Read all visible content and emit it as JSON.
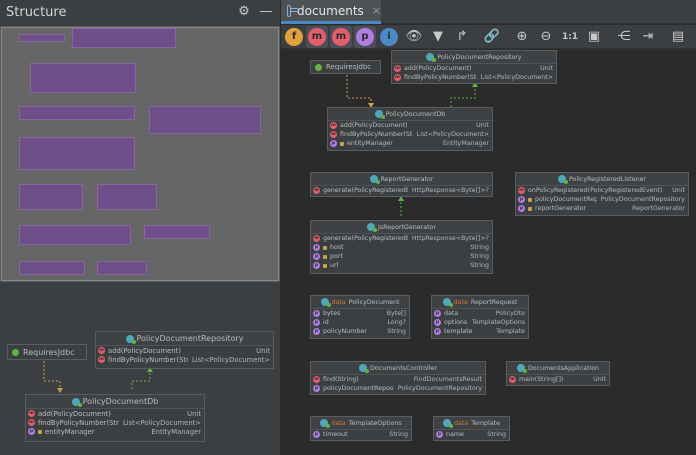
{
  "structure_panel": {
    "title": "Structure",
    "icons": [
      "gear-icon",
      "minimize-icon"
    ]
  },
  "editor": {
    "tab_label": "documents",
    "tab_close": "×",
    "toolbar_icons": [
      "fields-icon",
      "constructors-icon",
      "methods-icon",
      "properties-icon",
      "inner-classes-icon",
      "eye-icon",
      "filter-icon",
      "route-icon",
      "link-icon",
      "zoom-in-icon",
      "zoom-out-icon",
      "actual-size-icon",
      "fit-content-icon",
      "layout-icon",
      "export-icon",
      "save-icon"
    ],
    "toolbar_letters": [
      "f",
      "m",
      "m",
      "p",
      "i"
    ],
    "actual_size_label": "1:1",
    "colors": {
      "accent": "#4a88c7",
      "field": "#e35f6d",
      "property": "#b07de0",
      "inherit": "#62b543"
    }
  },
  "diagram": {
    "requires_jdbc": "RequiresJdbc",
    "policy_document_repository": {
      "name": "PolicyDocumentRepository",
      "rows": [
        {
          "name": "add(PolicyDocument)",
          "type": "Unit"
        },
        {
          "name": "findByPolicyNumber(String)",
          "type": "List<PolicyDocument>"
        }
      ]
    },
    "policy_document_db": {
      "name": "PolicyDocumentDb",
      "rows": [
        {
          "name": "add(PolicyDocument)",
          "type": "Unit"
        },
        {
          "name": "findByPolicyNumber(String)",
          "type": "List<PolicyDocument>"
        },
        {
          "name": "entityManager",
          "type": "EntityManager"
        }
      ]
    },
    "report_generator": {
      "name": "ReportGenerator",
      "rows": [
        {
          "name": "generate(PolicyRegisteredEvent)",
          "type": "HttpResponse<Byte[]>?"
        }
      ]
    },
    "js_report_generator": {
      "name": "JsReportGenerator",
      "rows": [
        {
          "name": "generate(PolicyRegisteredEvent)",
          "type": "HttpResponse<Byte[]>?"
        },
        {
          "name": "host",
          "type": "String"
        },
        {
          "name": "port",
          "type": "String"
        },
        {
          "name": "url",
          "type": "String"
        }
      ]
    },
    "policy_registered_listener": {
      "name": "PolicyRegisteredListener",
      "rows": [
        {
          "name": "onPolicyRegistered(PolicyRegisteredEvent)",
          "type": "Unit"
        },
        {
          "name": "policyDocumentRepository",
          "type": "PolicyDocumentRepository"
        },
        {
          "name": "reportGenerator",
          "type": "ReportGenerator"
        }
      ]
    },
    "policy_document": {
      "kw": "data",
      "name": "PolicyDocument",
      "rows": [
        {
          "name": "bytes",
          "type": "Byte[]"
        },
        {
          "name": "id",
          "type": "Long?"
        },
        {
          "name": "policyNumber",
          "type": "String"
        }
      ]
    },
    "report_request": {
      "kw": "data",
      "name": "ReportRequest",
      "rows": [
        {
          "name": "data",
          "type": "PolicyDto"
        },
        {
          "name": "options",
          "type": "TemplateOptions"
        },
        {
          "name": "template",
          "type": "Template"
        }
      ]
    },
    "documents_controller": {
      "name": "DocumentsController",
      "rows": [
        {
          "name": "find(String)",
          "type": "FindDocumentsResult"
        },
        {
          "name": "policyDocumentRepository",
          "type": "PolicyDocumentRepository"
        }
      ]
    },
    "documents_application": {
      "name": "DocumentsApplication",
      "rows": [
        {
          "name": "main(String[])",
          "type": "Unit"
        }
      ]
    },
    "template_options": {
      "kw": "data",
      "name": "TemplateOptions",
      "rows": [
        {
          "name": "timeout",
          "type": "String"
        }
      ]
    },
    "template": {
      "kw": "data",
      "name": "Template",
      "rows": [
        {
          "name": "name",
          "type": "String"
        }
      ]
    }
  }
}
